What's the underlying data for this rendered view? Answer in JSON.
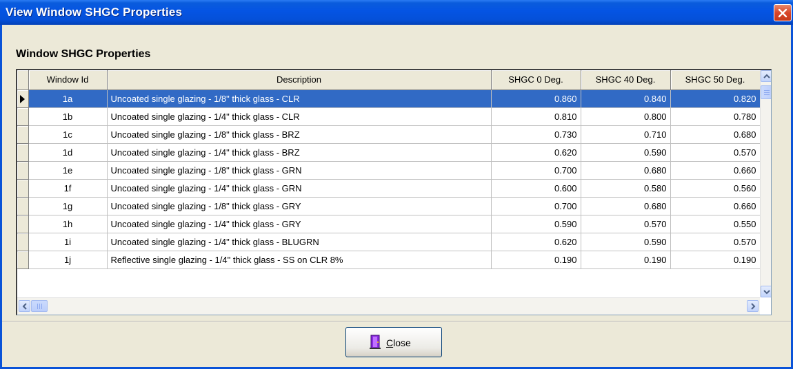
{
  "window": {
    "title": "View Window SHGC Properties"
  },
  "group": {
    "title": "Window SHGC Properties"
  },
  "table": {
    "columns": [
      "Window Id",
      "Description",
      "SHGC 0 Deg.",
      "SHGC 40 Deg.",
      "SHGC 50 Deg."
    ],
    "selected_row": 0,
    "rows": [
      {
        "id": "1a",
        "desc": "Uncoated single glazing - 1/8\" thick glass - CLR",
        "s0": "0.860",
        "s40": "0.840",
        "s50": "0.820"
      },
      {
        "id": "1b",
        "desc": "Uncoated single glazing - 1/4\" thick glass - CLR",
        "s0": "0.810",
        "s40": "0.800",
        "s50": "0.780"
      },
      {
        "id": "1c",
        "desc": "Uncoated single glazing - 1/8\" thick glass - BRZ",
        "s0": "0.730",
        "s40": "0.710",
        "s50": "0.680"
      },
      {
        "id": "1d",
        "desc": "Uncoated single glazing - 1/4\" thick glass - BRZ",
        "s0": "0.620",
        "s40": "0.590",
        "s50": "0.570"
      },
      {
        "id": "1e",
        "desc": "Uncoated single glazing - 1/8\" thick glass - GRN",
        "s0": "0.700",
        "s40": "0.680",
        "s50": "0.660"
      },
      {
        "id": "1f",
        "desc": "Uncoated single glazing - 1/4\" thick glass - GRN",
        "s0": "0.600",
        "s40": "0.580",
        "s50": "0.560"
      },
      {
        "id": "1g",
        "desc": "Uncoated single glazing - 1/8\" thick glass - GRY",
        "s0": "0.700",
        "s40": "0.680",
        "s50": "0.660"
      },
      {
        "id": "1h",
        "desc": "Uncoated single glazing - 1/4\" thick glass - GRY",
        "s0": "0.590",
        "s40": "0.570",
        "s50": "0.550"
      },
      {
        "id": "1i",
        "desc": "Uncoated single glazing - 1/4\" thick glass - BLUGRN",
        "s0": "0.620",
        "s40": "0.590",
        "s50": "0.570"
      },
      {
        "id": "1j",
        "desc": "Reflective single glazing - 1/4\" thick glass - SS on CLR 8%",
        "s0": "0.190",
        "s40": "0.190",
        "s50": "0.190"
      }
    ]
  },
  "buttons": {
    "close_label_underlined": "C",
    "close_label_rest": "lose",
    "close_icon": "door-exit-icon"
  },
  "colors": {
    "titlebar": "#0554e3",
    "selection": "#316ac5",
    "dialog_bg": "#ece9d8",
    "close_x": "#d8452a"
  }
}
